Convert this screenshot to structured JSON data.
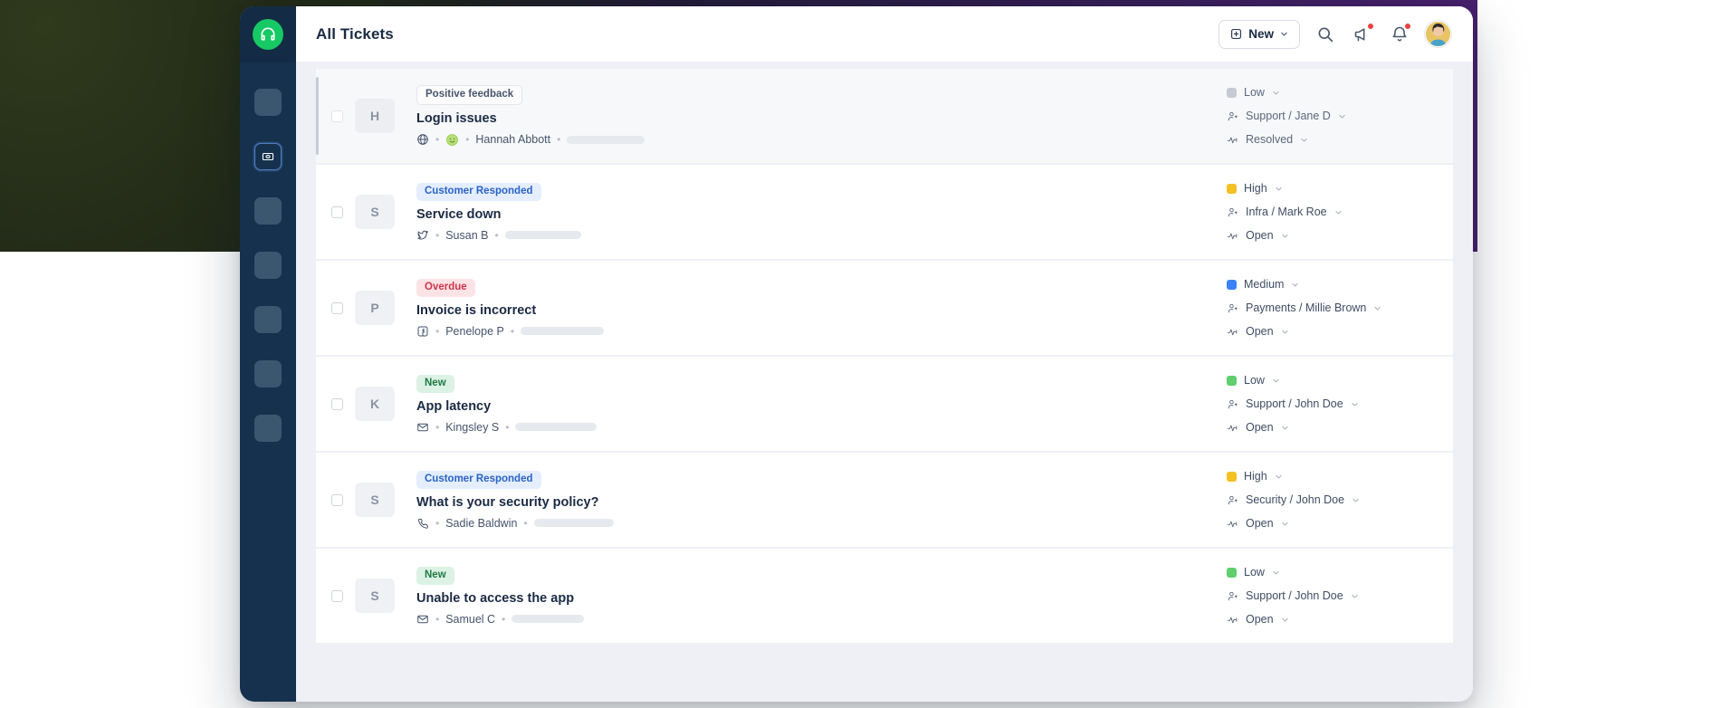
{
  "window": {
    "logo_icon": "headset-support-icon",
    "rail_items": [
      {
        "name": "rail-item-1",
        "icon": "placeholder-square-icon",
        "active": false
      },
      {
        "name": "rail-item-tickets",
        "icon": "ticket-icon",
        "active": true
      },
      {
        "name": "rail-item-3",
        "icon": "placeholder-square-icon",
        "active": false
      },
      {
        "name": "rail-item-4",
        "icon": "placeholder-square-icon",
        "active": false
      },
      {
        "name": "rail-item-5",
        "icon": "placeholder-square-icon",
        "active": false
      },
      {
        "name": "rail-item-6",
        "icon": "placeholder-square-icon",
        "active": false
      },
      {
        "name": "rail-item-7",
        "icon": "placeholder-square-icon",
        "active": false
      }
    ]
  },
  "header": {
    "title": "All Tickets",
    "new_button": {
      "label": "New",
      "plus_icon": "plus-square-icon",
      "chevron_icon": "chevron-down-icon"
    },
    "icons": [
      {
        "name": "search-icon",
        "badge": false
      },
      {
        "name": "megaphone-icon",
        "badge": true
      },
      {
        "name": "bell-icon",
        "badge": true
      }
    ],
    "avatar": {
      "name": "user-avatar"
    }
  },
  "colors": {
    "priority_low_muted": "#c5cad3",
    "priority_low": "#5fce6f",
    "priority_medium": "#3b82f6",
    "priority_high": "#f5c023",
    "accent_green": "#17c964",
    "badge_red_bg": "#fde3e6",
    "badge_blue_bg": "#e4eeff",
    "badge_green_bg": "#dcf2e4",
    "notification_dot": "#e8413f",
    "rail_bg": "#16314d"
  },
  "tickets": [
    {
      "selected": true,
      "checkbox_checked": false,
      "avatar_initial": "H",
      "badge": {
        "label": "Positive feedback",
        "style": "neutral"
      },
      "subject": "Login issues",
      "channel_icon": "globe-icon",
      "satisfaction_icon": "smiley-happy-icon",
      "requester": "Hannah Abbott",
      "skeleton_width": 86,
      "priority": {
        "label": "Low",
        "color": "#c5cad3"
      },
      "assignee": "Support / Jane D",
      "status": "Resolved"
    },
    {
      "selected": false,
      "checkbox_checked": false,
      "avatar_initial": "S",
      "badge": {
        "label": "Customer Responded",
        "style": "blue"
      },
      "subject": "Service down",
      "channel_icon": "twitter-icon",
      "satisfaction_icon": null,
      "requester": "Susan B",
      "skeleton_width": 84,
      "priority": {
        "label": "High",
        "color": "#f5c023"
      },
      "assignee": "Infra / Mark Roe",
      "status": "Open"
    },
    {
      "selected": false,
      "checkbox_checked": false,
      "avatar_initial": "P",
      "badge": {
        "label": "Overdue",
        "style": "red"
      },
      "subject": "Invoice is incorrect",
      "channel_icon": "facebook-icon",
      "satisfaction_icon": null,
      "requester": "Penelope P",
      "skeleton_width": 92,
      "priority": {
        "label": "Medium",
        "color": "#3b82f6"
      },
      "assignee": "Payments / Millie Brown",
      "status": "Open"
    },
    {
      "selected": false,
      "checkbox_checked": false,
      "avatar_initial": "K",
      "badge": {
        "label": "New",
        "style": "green"
      },
      "subject": "App latency",
      "channel_icon": "email-icon",
      "satisfaction_icon": null,
      "requester": "Kingsley S",
      "skeleton_width": 90,
      "priority": {
        "label": "Low",
        "color": "#5fce6f"
      },
      "assignee": "Support / John Doe",
      "status": "Open"
    },
    {
      "selected": false,
      "checkbox_checked": false,
      "avatar_initial": "S",
      "badge": {
        "label": "Customer Responded",
        "style": "blue"
      },
      "subject": "What is your security policy?",
      "channel_icon": "phone-icon",
      "satisfaction_icon": null,
      "requester": "Sadie Baldwin",
      "skeleton_width": 88,
      "priority": {
        "label": "High",
        "color": "#f5c023"
      },
      "assignee": "Security / John Doe",
      "status": "Open"
    },
    {
      "selected": false,
      "checkbox_checked": false,
      "avatar_initial": "S",
      "badge": {
        "label": "New",
        "style": "green"
      },
      "subject": "Unable to access the app",
      "channel_icon": "email-icon",
      "satisfaction_icon": null,
      "requester": "Samuel C",
      "skeleton_width": 80,
      "priority": {
        "label": "Low",
        "color": "#5fce6f"
      },
      "assignee": "Support / John Doe",
      "status": "Open"
    }
  ]
}
